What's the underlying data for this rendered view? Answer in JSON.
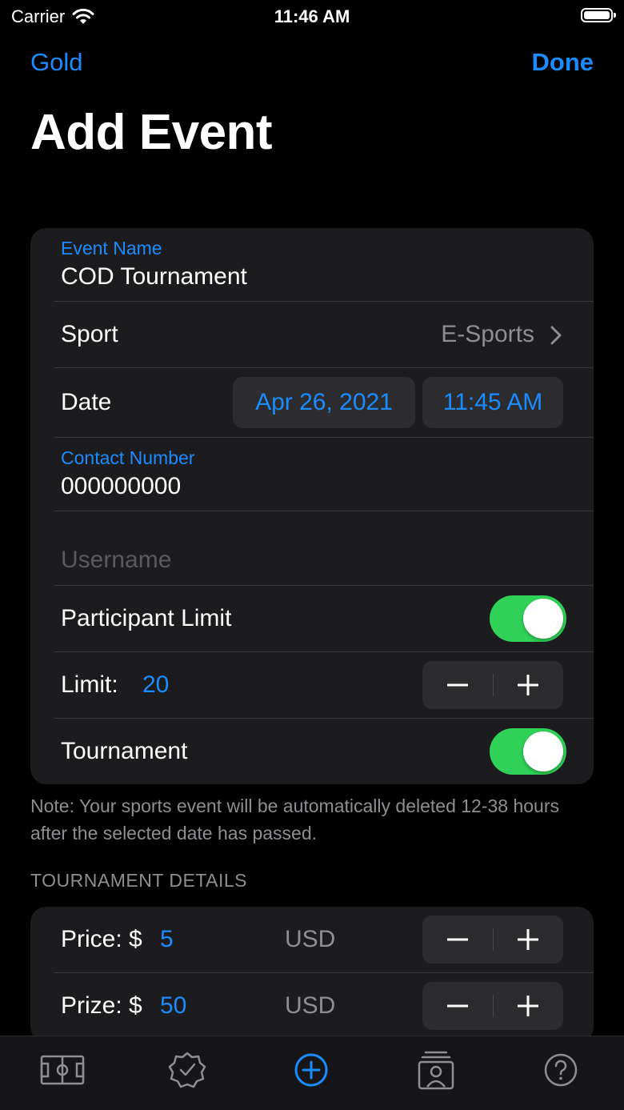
{
  "status": {
    "carrier": "Carrier",
    "time": "11:46 AM"
  },
  "nav": {
    "back_label": "Gold",
    "done_label": "Done"
  },
  "title": "Add Event",
  "form": {
    "event_name_label": "Event Name",
    "event_name_value": "COD Tournament",
    "sport_label": "Sport",
    "sport_value": "E-Sports",
    "date_label": "Date",
    "date_value": "Apr 26, 2021",
    "time_value": "11:45 AM",
    "contact_label": "Contact Number",
    "contact_value": "000000000",
    "username_placeholder": "Username",
    "participant_limit_label": "Participant Limit",
    "participant_limit_on": true,
    "limit_label": "Limit:",
    "limit_value": "20",
    "tournament_label": "Tournament",
    "tournament_on": true
  },
  "note": "Note: Your sports event will be automatically deleted 12-38 hours after the selected date has passed.",
  "tournament_details": {
    "header": "TOURNAMENT DETAILS",
    "price_label": "Price: $",
    "price_value": "5",
    "price_currency": "USD",
    "prize_label": "Prize: $",
    "prize_value": "50",
    "prize_currency": "USD"
  },
  "tabs": [
    {
      "icon": "field-icon",
      "active": false
    },
    {
      "icon": "badge-check-icon",
      "active": false
    },
    {
      "icon": "plus-circle-icon",
      "active": true
    },
    {
      "icon": "contact-card-icon",
      "active": false
    },
    {
      "icon": "help-circle-icon",
      "active": false
    }
  ],
  "colors": {
    "accent": "#1a8cff",
    "toggle_on": "#30d158",
    "card": "#1c1c1e",
    "background": "#000000"
  }
}
